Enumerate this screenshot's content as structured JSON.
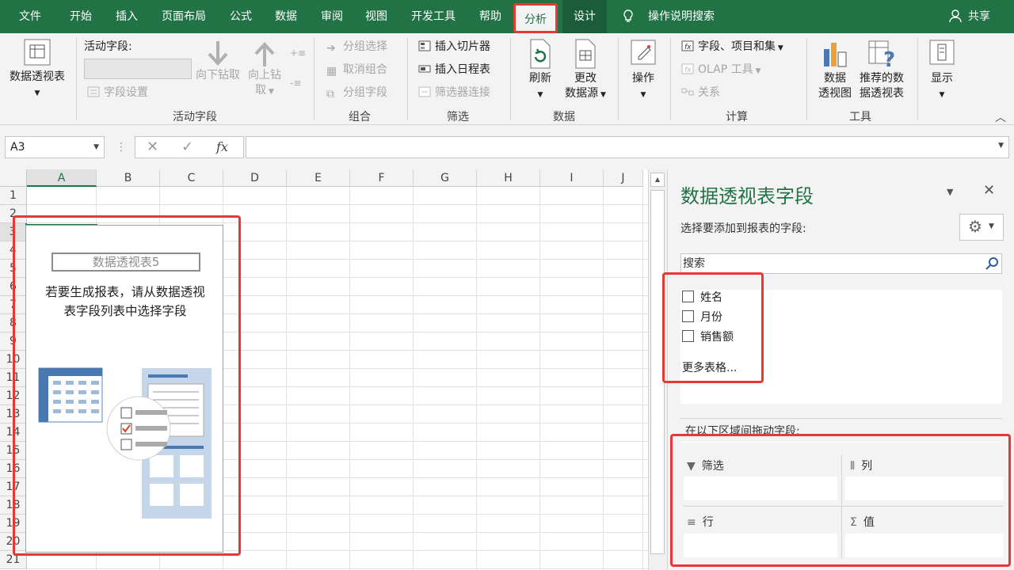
{
  "tabs": [
    {
      "label": "文件"
    },
    {
      "label": "开始"
    },
    {
      "label": "插入"
    },
    {
      "label": "页面布局"
    },
    {
      "label": "公式"
    },
    {
      "label": "数据"
    },
    {
      "label": "审阅"
    },
    {
      "label": "视图"
    },
    {
      "label": "开发工具"
    },
    {
      "label": "帮助"
    },
    {
      "label": "分析"
    },
    {
      "label": "设计"
    }
  ],
  "tellme": "操作说明搜索",
  "share": "共享",
  "ribbon": {
    "pivot_table": {
      "label": "数据透视表"
    },
    "active_field": {
      "label": "活动字段:",
      "settings": "字段设置",
      "drill_down": "向下钻取",
      "drill_up_1": "向上钻",
      "drill_up_2": "取",
      "group_title": "活动字段"
    },
    "group": {
      "items": [
        "分组选择",
        "取消组合",
        "分组字段"
      ],
      "group_title": "组合"
    },
    "filter": {
      "items": [
        "插入切片器",
        "插入日程表",
        "筛选器连接"
      ],
      "group_title": "筛选"
    },
    "data": {
      "refresh": "刷新",
      "change_source_1": "更改",
      "change_source_2": "数据源",
      "group_title": "数据"
    },
    "actions": {
      "label": "操作"
    },
    "calc": {
      "items": [
        "字段、项目和集",
        "OLAP 工具",
        "关系"
      ],
      "group_title": "计算"
    },
    "tools": {
      "pivot_chart_1": "数据",
      "pivot_chart_2": "透视图",
      "recommended_1": "推荐的数",
      "recommended_2": "据透视表",
      "group_title": "工具"
    },
    "show": {
      "label": "显示"
    }
  },
  "namebox": "A3",
  "fx_label": "fx",
  "columns": [
    "A",
    "B",
    "C",
    "D",
    "E",
    "F",
    "G",
    "H",
    "I",
    "J"
  ],
  "rows": [
    "1",
    "2",
    "3",
    "4",
    "5",
    "6",
    "7",
    "8",
    "9",
    "10",
    "11",
    "12",
    "13",
    "14",
    "15",
    "16",
    "17",
    "18",
    "19",
    "20",
    "21"
  ],
  "pivot": {
    "name": "数据透视表5",
    "message_1": "若要生成报表，请从数据透视",
    "message_2": "表字段列表中选择字段"
  },
  "panel": {
    "title": "数据透视表字段",
    "subtitle": "选择要添加到报表的字段:",
    "search_placeholder": "搜索",
    "fields": [
      {
        "label": "姓名"
      },
      {
        "label": "月份"
      },
      {
        "label": "销售额"
      }
    ],
    "more_tables": "更多表格...",
    "drag_hint": "在以下区域间拖动字段:",
    "areas": {
      "filter": "筛选",
      "columns": "列",
      "rows": "行",
      "values": "值"
    }
  },
  "colors": {
    "accent": "#217346",
    "highlight": "#e53935"
  }
}
